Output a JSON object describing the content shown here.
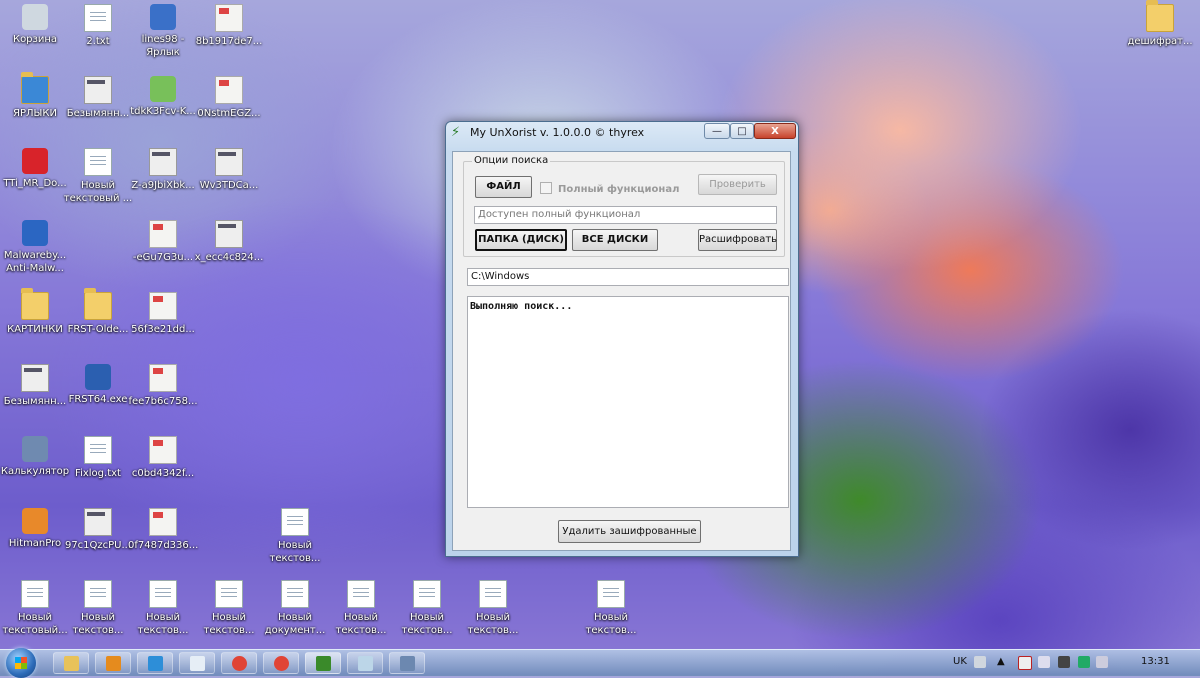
{
  "desktop": {
    "icons": [
      {
        "label": "Корзина",
        "icon": "recycle-bin-icon"
      },
      {
        "label": "2.txt",
        "icon": "text-file-icon"
      },
      {
        "label": "lines98 -\nЯрлык",
        "icon": "app-shortcut-icon"
      },
      {
        "label": "8b1917de7...",
        "icon": "envelope-file-icon"
      },
      {
        "label": "ЯРЛЫКИ",
        "icon": "shortcuts-folder-icon"
      },
      {
        "label": "Безымянн...",
        "icon": "image-file-icon"
      },
      {
        "label": "tdkK3Fcv-K...",
        "icon": "android-file-icon"
      },
      {
        "label": "0NstmEGZ...",
        "icon": "envelope-file-icon"
      },
      {
        "label": "TTi_MR_Do...",
        "icon": "trend-micro-icon"
      },
      {
        "label": "Новый\nтекстовый ...",
        "icon": "text-file-icon"
      },
      {
        "label": "Z-a9JbiXbk...",
        "icon": "image-file-icon"
      },
      {
        "label": "Wv3TDCa...",
        "icon": "image-file-icon"
      },
      {
        "label": "Malwareby...\nAnti-Malw...",
        "icon": "malwarebytes-icon"
      },
      {
        "label": "-eGu7G3u...",
        "icon": "envelope-file-icon"
      },
      {
        "label": "x_ecc4c824...",
        "icon": "image-file-icon"
      },
      {
        "label": "КАРТИНКИ",
        "icon": "folder-icon"
      },
      {
        "label": "FRST-Olde...",
        "icon": "folder-icon"
      },
      {
        "label": "56f3e21dd...",
        "icon": "envelope-file-icon"
      },
      {
        "label": "Безымянн...",
        "icon": "image-file-icon"
      },
      {
        "label": "FRST64.exe",
        "icon": "frst-app-icon"
      },
      {
        "label": "fee7b6c758...",
        "icon": "envelope-file-icon"
      },
      {
        "label": "Калькулятор",
        "icon": "calculator-icon"
      },
      {
        "label": "Fixlog.txt",
        "icon": "text-file-icon"
      },
      {
        "label": "c0bd4342f...",
        "icon": "envelope-file-icon"
      },
      {
        "label": "HitmanPro",
        "icon": "hitmanpro-icon"
      },
      {
        "label": "97c1QzcPU...",
        "icon": "image-file-icon"
      },
      {
        "label": "0f7487d336...",
        "icon": "envelope-file-icon"
      },
      {
        "label": "Новый\nтекстов...",
        "icon": "text-file-icon"
      },
      {
        "label": "Новый\nтекстовый...",
        "icon": "text-file-icon"
      },
      {
        "label": "Новый\nтекстов...",
        "icon": "text-file-icon"
      },
      {
        "label": "Новый\nтекстов...",
        "icon": "text-file-icon"
      },
      {
        "label": "Новый\nтекстов...",
        "icon": "text-file-icon"
      },
      {
        "label": "Новый\nдокумент...",
        "icon": "document-file-icon"
      },
      {
        "label": "Новый\nтекстов...",
        "icon": "text-file-icon"
      },
      {
        "label": "Новый\nтекстов...",
        "icon": "text-file-icon"
      },
      {
        "label": "Новый\nтекстов...",
        "icon": "text-file-icon"
      },
      {
        "label": "Новый\nтекстов...",
        "icon": "text-file-icon"
      },
      {
        "label": "дешифрат...",
        "icon": "folder-icon"
      }
    ]
  },
  "window": {
    "title": "My UnXorist v. 1.0.0.0 © thyrex",
    "controls": {
      "minimize": "—",
      "maximize": "□",
      "close": "X"
    },
    "group_title": "Опции поиска",
    "file_button": "ФАЙЛ",
    "full_function_checkbox": "Полный функционал",
    "full_function_checked": false,
    "check_button": "Проверить",
    "status_field": "Доступен полный функционал",
    "folder_button": "ПАПКА (ДИСК)",
    "all_disks_button": "ВСЕ ДИСКИ",
    "decrypt_button": "Расшифровать",
    "path_field": "C:\\Windows",
    "log_text": "Выполняю поиск...",
    "delete_button": "Удалить зашифрованные"
  },
  "taskbar": {
    "apps": [
      "explorer-icon",
      "media-player-icon",
      "internet-explorer-icon",
      "notepad-icon",
      "chrome-icon",
      "chrome-icon",
      "unxorist-icon",
      "notepad2-icon",
      "screenshot-tool-icon"
    ],
    "active_app_index": 6,
    "language": "UK",
    "clock": "13:31"
  }
}
